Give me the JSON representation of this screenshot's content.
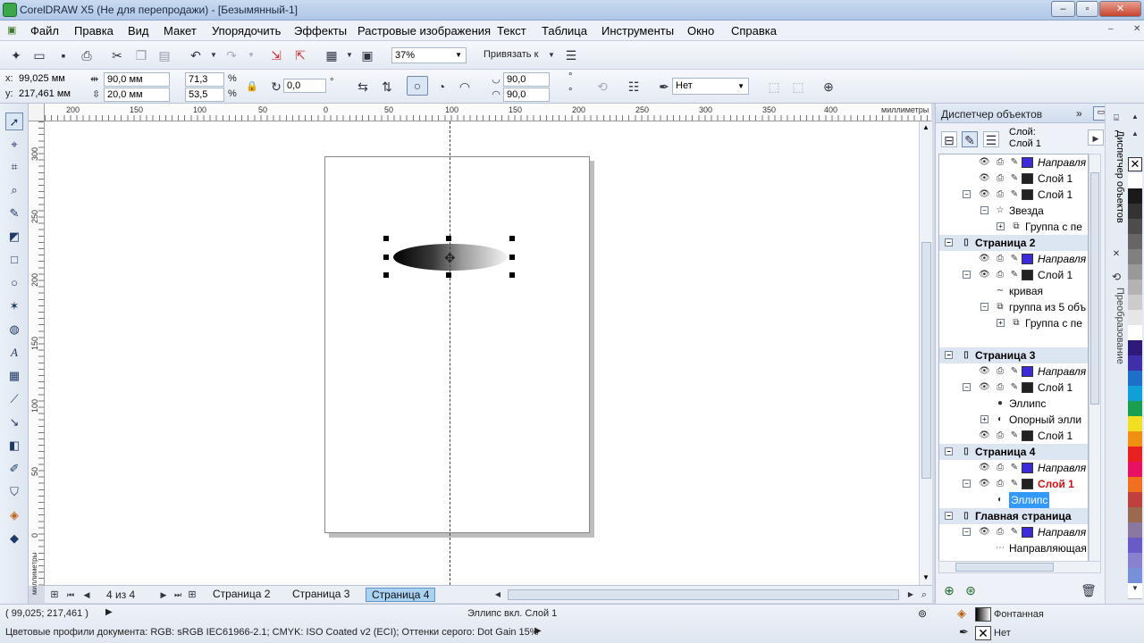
{
  "window": {
    "title": "CorelDRAW X5 (Не для перепродажи) - [Безымянный-1]",
    "min": "–",
    "restore": "▫",
    "close": "✕"
  },
  "menu": [
    "Файл",
    "Правка",
    "Вид",
    "Макет",
    "Упорядочить",
    "Эффекты",
    "Растровые изображения",
    "Текст",
    "Таблица",
    "Инструменты",
    "Окно",
    "Справка"
  ],
  "toolbar": {
    "zoom": "37%",
    "snap_label": "Привязать к"
  },
  "props": {
    "x_label": "x:",
    "x": "99,025 мм",
    "y_label": "y:",
    "y": "217,461 мм",
    "w": "90,0 мм",
    "h": "20,0 мм",
    "scale_w": "71,3",
    "scale_h": "53,5",
    "pct": "%",
    "angle": "0,0",
    "deg": "°",
    "arc_start": "90,0",
    "arc_end": "90,0",
    "outline": "Нет"
  },
  "ruler": {
    "top_ticks": [
      "200",
      "150",
      "100",
      "50",
      "0",
      "50",
      "100",
      "150",
      "200",
      "250",
      "300",
      "350",
      "400"
    ],
    "unit": "миллиметры",
    "left_ticks": [
      "300",
      "250",
      "200",
      "150",
      "100",
      "50",
      "0"
    ],
    "left_unit": "миллиметры"
  },
  "page_nav": {
    "counter": "4 из 4",
    "tabs": [
      "Страница 2",
      "Страница 3",
      "Страница 4"
    ],
    "active": "Страница 4"
  },
  "status": {
    "coords": "( 99,025; 217,461 )",
    "object": "Эллипс вкл. Слой 1",
    "profiles": "Цветовые профили документа: RGB: sRGB IEC61966-2.1; CMYK: ISO Coated v2 (ECI); Оттенки серого: Dot Gain 15%",
    "fill": "Фонтанная",
    "outline": "Нет"
  },
  "docker": {
    "title": "Диспетчер объектов",
    "layer_caption": "Слой:",
    "layer_name": "Слой 1",
    "side_tab1": "Диспетчер объектов",
    "side_tab2": "Преобразование",
    "rows": [
      {
        "type": "layer",
        "indent": 0,
        "exp": "",
        "name": "Направля",
        "italic": true,
        "color": "#3b2bd8"
      },
      {
        "type": "layer",
        "indent": 0,
        "exp": "",
        "name": "Слой 1",
        "color": "#222222"
      },
      {
        "type": "layer",
        "indent": 0,
        "exp": "−",
        "name": "Слой 1",
        "color": "#222222"
      },
      {
        "type": "obj",
        "indent": 1,
        "exp": "−",
        "icon": "☆",
        "name": "Звезда"
      },
      {
        "type": "obj",
        "indent": 2,
        "exp": "+",
        "icon": "⧉",
        "name": "Группа с пе"
      },
      {
        "type": "page",
        "exp": "−",
        "name": "Страница 2"
      },
      {
        "type": "layer",
        "indent": 0,
        "exp": "",
        "name": "Направля",
        "italic": true,
        "color": "#3b2bd8"
      },
      {
        "type": "layer",
        "indent": 0,
        "exp": "−",
        "name": "Слой 1",
        "color": "#222222"
      },
      {
        "type": "obj",
        "indent": 1,
        "exp": "",
        "icon": "∼",
        "name": "кривая"
      },
      {
        "type": "obj",
        "indent": 1,
        "exp": "−",
        "icon": "⧉",
        "name": "группа из 5 объ"
      },
      {
        "type": "obj",
        "indent": 2,
        "exp": "+",
        "icon": "⧉",
        "name": "Группа с пе"
      },
      {
        "type": "blank"
      },
      {
        "type": "page",
        "exp": "−",
        "name": "Страница 3"
      },
      {
        "type": "layer",
        "indent": 0,
        "exp": "",
        "name": "Направля",
        "italic": true,
        "color": "#3b2bd8"
      },
      {
        "type": "layer",
        "indent": 0,
        "exp": "−",
        "name": "Слой 1",
        "color": "#222222"
      },
      {
        "type": "obj",
        "indent": 1,
        "exp": "",
        "icon": "●",
        "name": "Эллипс"
      },
      {
        "type": "obj",
        "indent": 1,
        "exp": "+",
        "icon": "◐",
        "name": "Опорный элли"
      },
      {
        "type": "layer",
        "indent": 0,
        "exp": "",
        "name": "Слой 1",
        "color": "#222222"
      },
      {
        "type": "page",
        "exp": "−",
        "name": "Страница 4"
      },
      {
        "type": "layer",
        "indent": 0,
        "exp": "",
        "name": "Направля",
        "italic": true,
        "color": "#3b2bd8"
      },
      {
        "type": "layer",
        "indent": 0,
        "exp": "−",
        "name": "Слой 1",
        "color": "#222222",
        "active": true
      },
      {
        "type": "obj",
        "indent": 1,
        "exp": "",
        "icon": "◐",
        "name": "Эллипс",
        "selected": true
      },
      {
        "type": "page",
        "exp": "−",
        "name": "Главная страница"
      },
      {
        "type": "layer",
        "indent": 0,
        "exp": "−",
        "name": "Направля",
        "italic": true,
        "color": "#3b2bd8"
      },
      {
        "type": "obj",
        "indent": 1,
        "exp": "",
        "icon": "⋯",
        "name": "Направляющая"
      }
    ]
  },
  "palette": [
    "#ffffff",
    "#1a1a1a",
    "#333333",
    "#4d4d4d",
    "#666666",
    "#808080",
    "#999999",
    "#b3b3b3",
    "#cccccc",
    "#e6e6e6",
    "#ffffff",
    "#2e1a78",
    "#3f2fa8",
    "#1e6fc8",
    "#10a0d8",
    "#18a050",
    "#f0e020",
    "#f09010",
    "#e82020",
    "#e81060",
    "#f07020",
    "#c04040",
    "#9a6a50",
    "#8a78a0",
    "#6a5ac8",
    "#8a80d0",
    "#7890d8",
    "#ffffff"
  ]
}
